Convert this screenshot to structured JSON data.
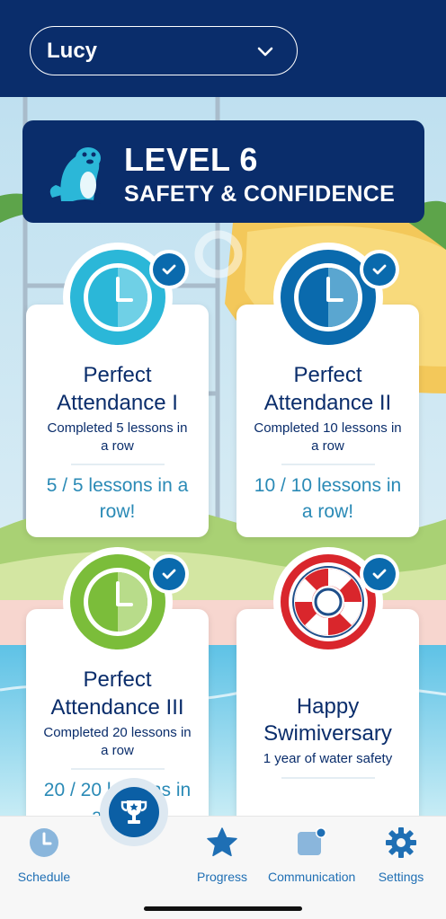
{
  "header": {
    "student_name": "Lucy",
    "dropdown_icon": "chevron-down-icon"
  },
  "level": {
    "title": "LEVEL 6",
    "subtitle": "SAFETY & CONFIDENCE",
    "mascot_icon": "seal-mascot-icon"
  },
  "badges": [
    {
      "title_line1": "Perfect",
      "title_line2": "Attendance I",
      "description_line1": "Completed 5 lessons in",
      "description_line2": "a row",
      "progress_line1": "5 / 5 lessons in a",
      "progress_line2": "row!",
      "icon": "clock-icon",
      "color": "#2bb7d8",
      "completed": true
    },
    {
      "title_line1": "Perfect",
      "title_line2": "Attendance II",
      "description_line1": "Completed 10 lessons in",
      "description_line2": "a row",
      "progress_line1": "10 / 10 lessons in",
      "progress_line2": "a row!",
      "icon": "clock-icon",
      "color": "#0a6aad",
      "completed": true
    },
    {
      "title_line1": "Perfect",
      "title_line2": "Attendance III",
      "description_line1": "Completed 20 lessons in",
      "description_line2": "a row",
      "progress_line1": "20 / 20 lessons in",
      "progress_line2": "a row!",
      "icon": "clock-icon",
      "color": "#7bbd3a",
      "completed": true
    },
    {
      "title_line1": "Happy",
      "title_line2": "Swimiversary",
      "description_line1": "1 year of water safety",
      "icon": "lifebuoy-icon",
      "color": "#d9262c",
      "completed": true
    }
  ],
  "nav": {
    "schedule": "Schedule",
    "progress": "Progress",
    "communication": "Communication",
    "settings": "Settings",
    "center_icon": "trophy-icon"
  },
  "colors": {
    "navy": "#0a2d6b",
    "accent_blue": "#1f6fb4",
    "progress_text": "#2a8ab6"
  }
}
